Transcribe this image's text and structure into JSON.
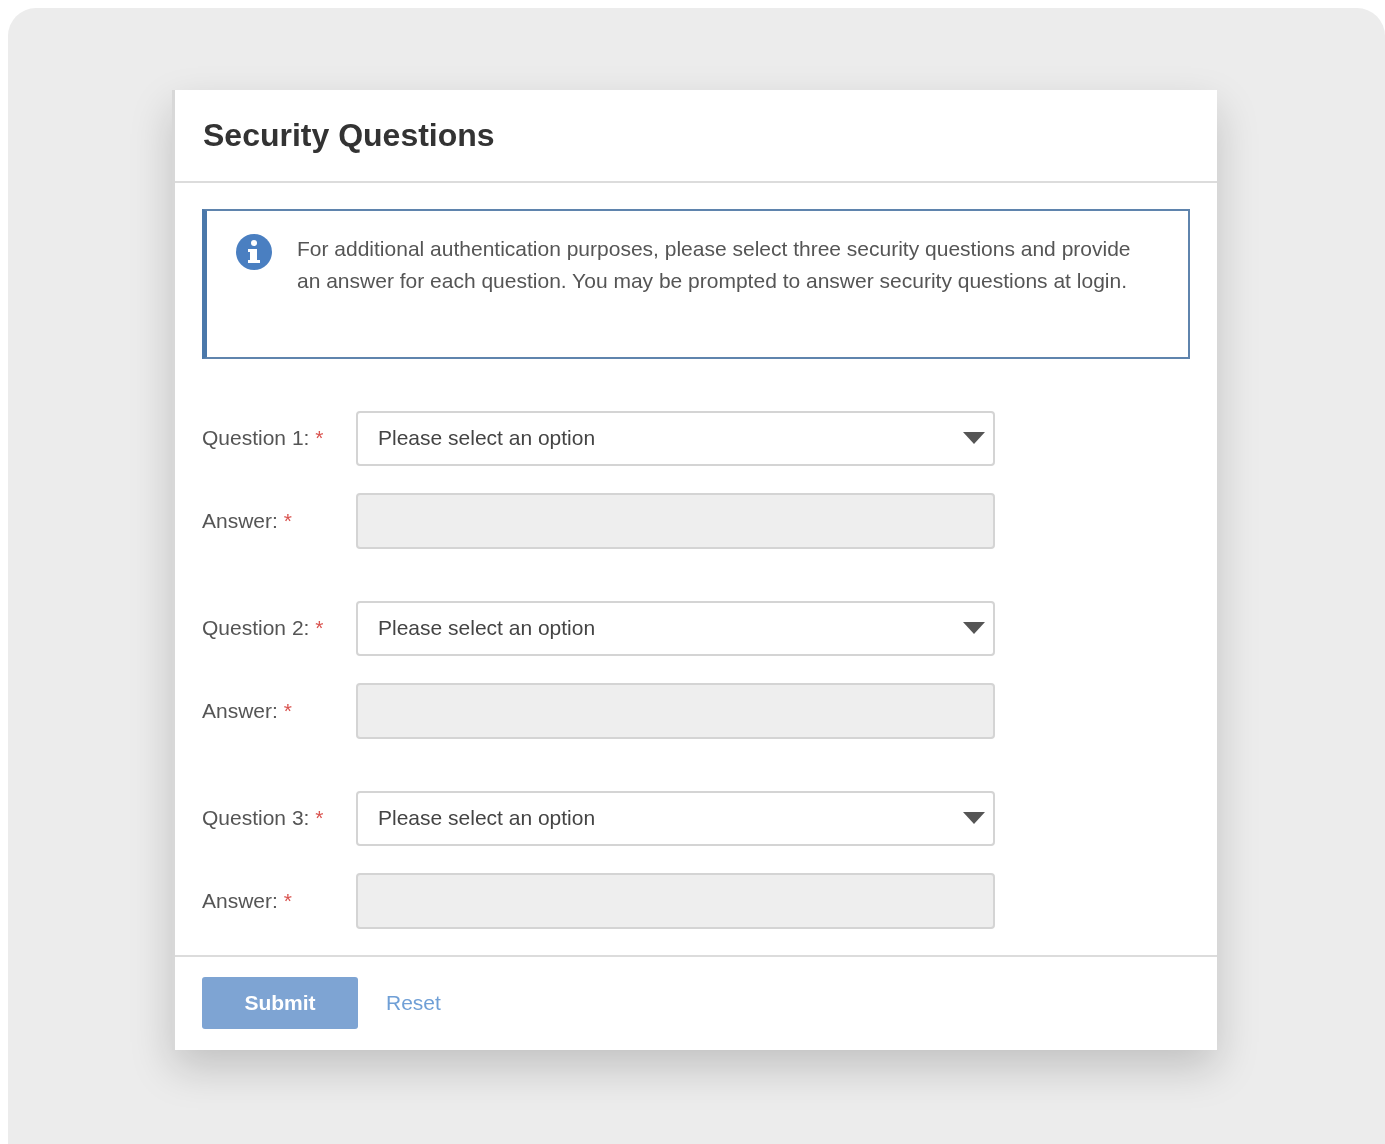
{
  "dialog": {
    "title": "Security Questions"
  },
  "notice": {
    "text": "For additional authentication purposes, please select three security questions and provide an answer for each question. You may be prompted to answer security questions at login."
  },
  "questions": [
    {
      "label": "Question 1:",
      "required_mark": "*",
      "placeholder": "Please select an option",
      "answer": {
        "label": "Answer:",
        "required_mark": "*",
        "disabled": true
      }
    },
    {
      "label": "Question 2:",
      "required_mark": "*",
      "placeholder": "Please select an option",
      "answer": {
        "label": "Answer:",
        "required_mark": "*",
        "disabled": true
      }
    },
    {
      "label": "Question 3:",
      "required_mark": "*",
      "placeholder": "Please select an option",
      "answer": {
        "label": "Answer:",
        "required_mark": "*",
        "disabled": true
      }
    }
  ],
  "actions": {
    "submit": {
      "label": "Submit",
      "disabled": true
    },
    "reset": {
      "label": "Reset"
    }
  }
}
